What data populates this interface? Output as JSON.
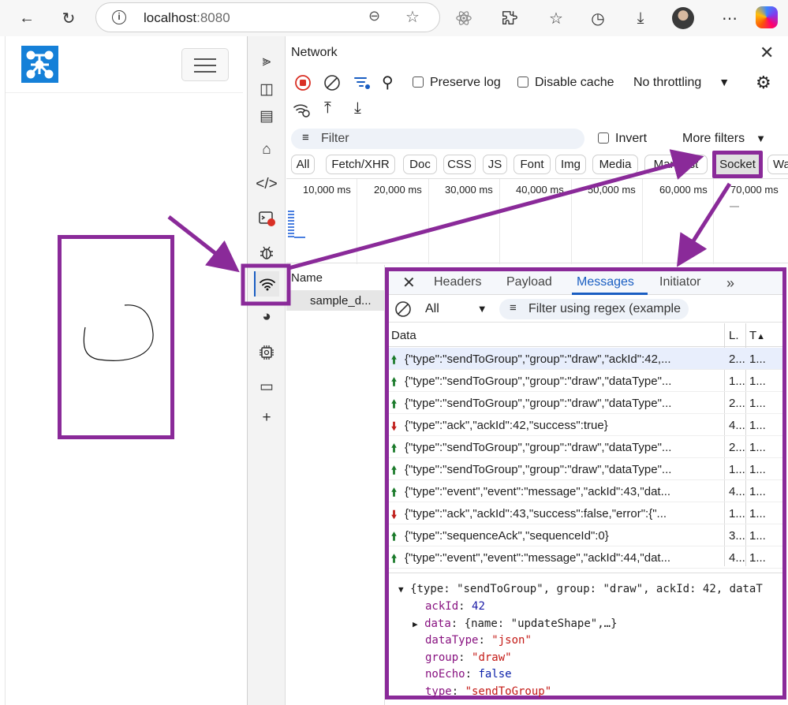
{
  "browser": {
    "url_host": "localhost",
    "url_port": ":8080"
  },
  "devtools": {
    "title": "Network",
    "preserve_log": "Preserve log",
    "disable_cache": "Disable cache",
    "throttling": "No throttling",
    "filter_placeholder": "Filter",
    "invert": "Invert",
    "more_filters": "More filters",
    "type_filters": [
      "All",
      "Fetch/XHR",
      "Doc",
      "CSS",
      "JS",
      "Font",
      "Img",
      "Media",
      "Manifest",
      "Socket",
      "Wa"
    ],
    "timeline_ticks": [
      "10,000 ms",
      "20,000 ms",
      "30,000 ms",
      "40,000 ms",
      "50,000 ms",
      "60,000 ms",
      "70,000 ms"
    ],
    "name_header": "Name",
    "request_name": "sample_d..."
  },
  "messages_panel": {
    "tabs": [
      "Headers",
      "Payload",
      "Messages",
      "Initiator"
    ],
    "direction_filter": "All",
    "regex_placeholder": "Filter using regex (example",
    "col_data": "Data",
    "col_length": "L.",
    "col_time": "T",
    "rows": [
      {
        "dir": "up",
        "data": "{\"type\":\"sendToGroup\",\"group\":\"draw\",\"ackId\":42,...",
        "len": "2...",
        "time": "1..."
      },
      {
        "dir": "up",
        "data": "{\"type\":\"sendToGroup\",\"group\":\"draw\",\"dataType\"...",
        "len": "1...",
        "time": "1..."
      },
      {
        "dir": "up",
        "data": "{\"type\":\"sendToGroup\",\"group\":\"draw\",\"dataType\"...",
        "len": "2...",
        "time": "1..."
      },
      {
        "dir": "down",
        "data": "{\"type\":\"ack\",\"ackId\":42,\"success\":true}",
        "len": "4...",
        "time": "1..."
      },
      {
        "dir": "up",
        "data": "{\"type\":\"sendToGroup\",\"group\":\"draw\",\"dataType\"...",
        "len": "2...",
        "time": "1..."
      },
      {
        "dir": "up",
        "data": "{\"type\":\"sendToGroup\",\"group\":\"draw\",\"dataType\"...",
        "len": "1...",
        "time": "1..."
      },
      {
        "dir": "up",
        "data": "{\"type\":\"event\",\"event\":\"message\",\"ackId\":43,\"dat...",
        "len": "4...",
        "time": "1..."
      },
      {
        "dir": "down",
        "data": "{\"type\":\"ack\",\"ackId\":43,\"success\":false,\"error\":{\"...",
        "len": "1...",
        "time": "1..."
      },
      {
        "dir": "up",
        "data": "{\"type\":\"sequenceAck\",\"sequenceId\":0}",
        "len": "3...",
        "time": "1..."
      },
      {
        "dir": "up",
        "data": "{\"type\":\"event\",\"event\":\"message\",\"ackId\":44,\"dat...",
        "len": "4...",
        "time": "1..."
      }
    ],
    "detail": {
      "summary": "{type: \"sendToGroup\", group: \"draw\", ackId: 42, dataT",
      "props": [
        {
          "key": "ackId",
          "value": "42",
          "kind": "num"
        },
        {
          "key": "data",
          "value": "{name: \"updateShape\",…}",
          "kind": "obj"
        },
        {
          "key": "dataType",
          "value": "\"json\"",
          "kind": "str"
        },
        {
          "key": "group",
          "value": "\"draw\"",
          "kind": "str"
        },
        {
          "key": "noEcho",
          "value": "false",
          "kind": "bool"
        },
        {
          "key": "type",
          "value": "\"sendToGroup\"",
          "kind": "str"
        }
      ]
    }
  },
  "colors": {
    "highlight": "#8a2a99",
    "active_tab": "#1a5ec2",
    "send_arrow": "#1a7a2a",
    "receive_arrow": "#c0201c"
  }
}
